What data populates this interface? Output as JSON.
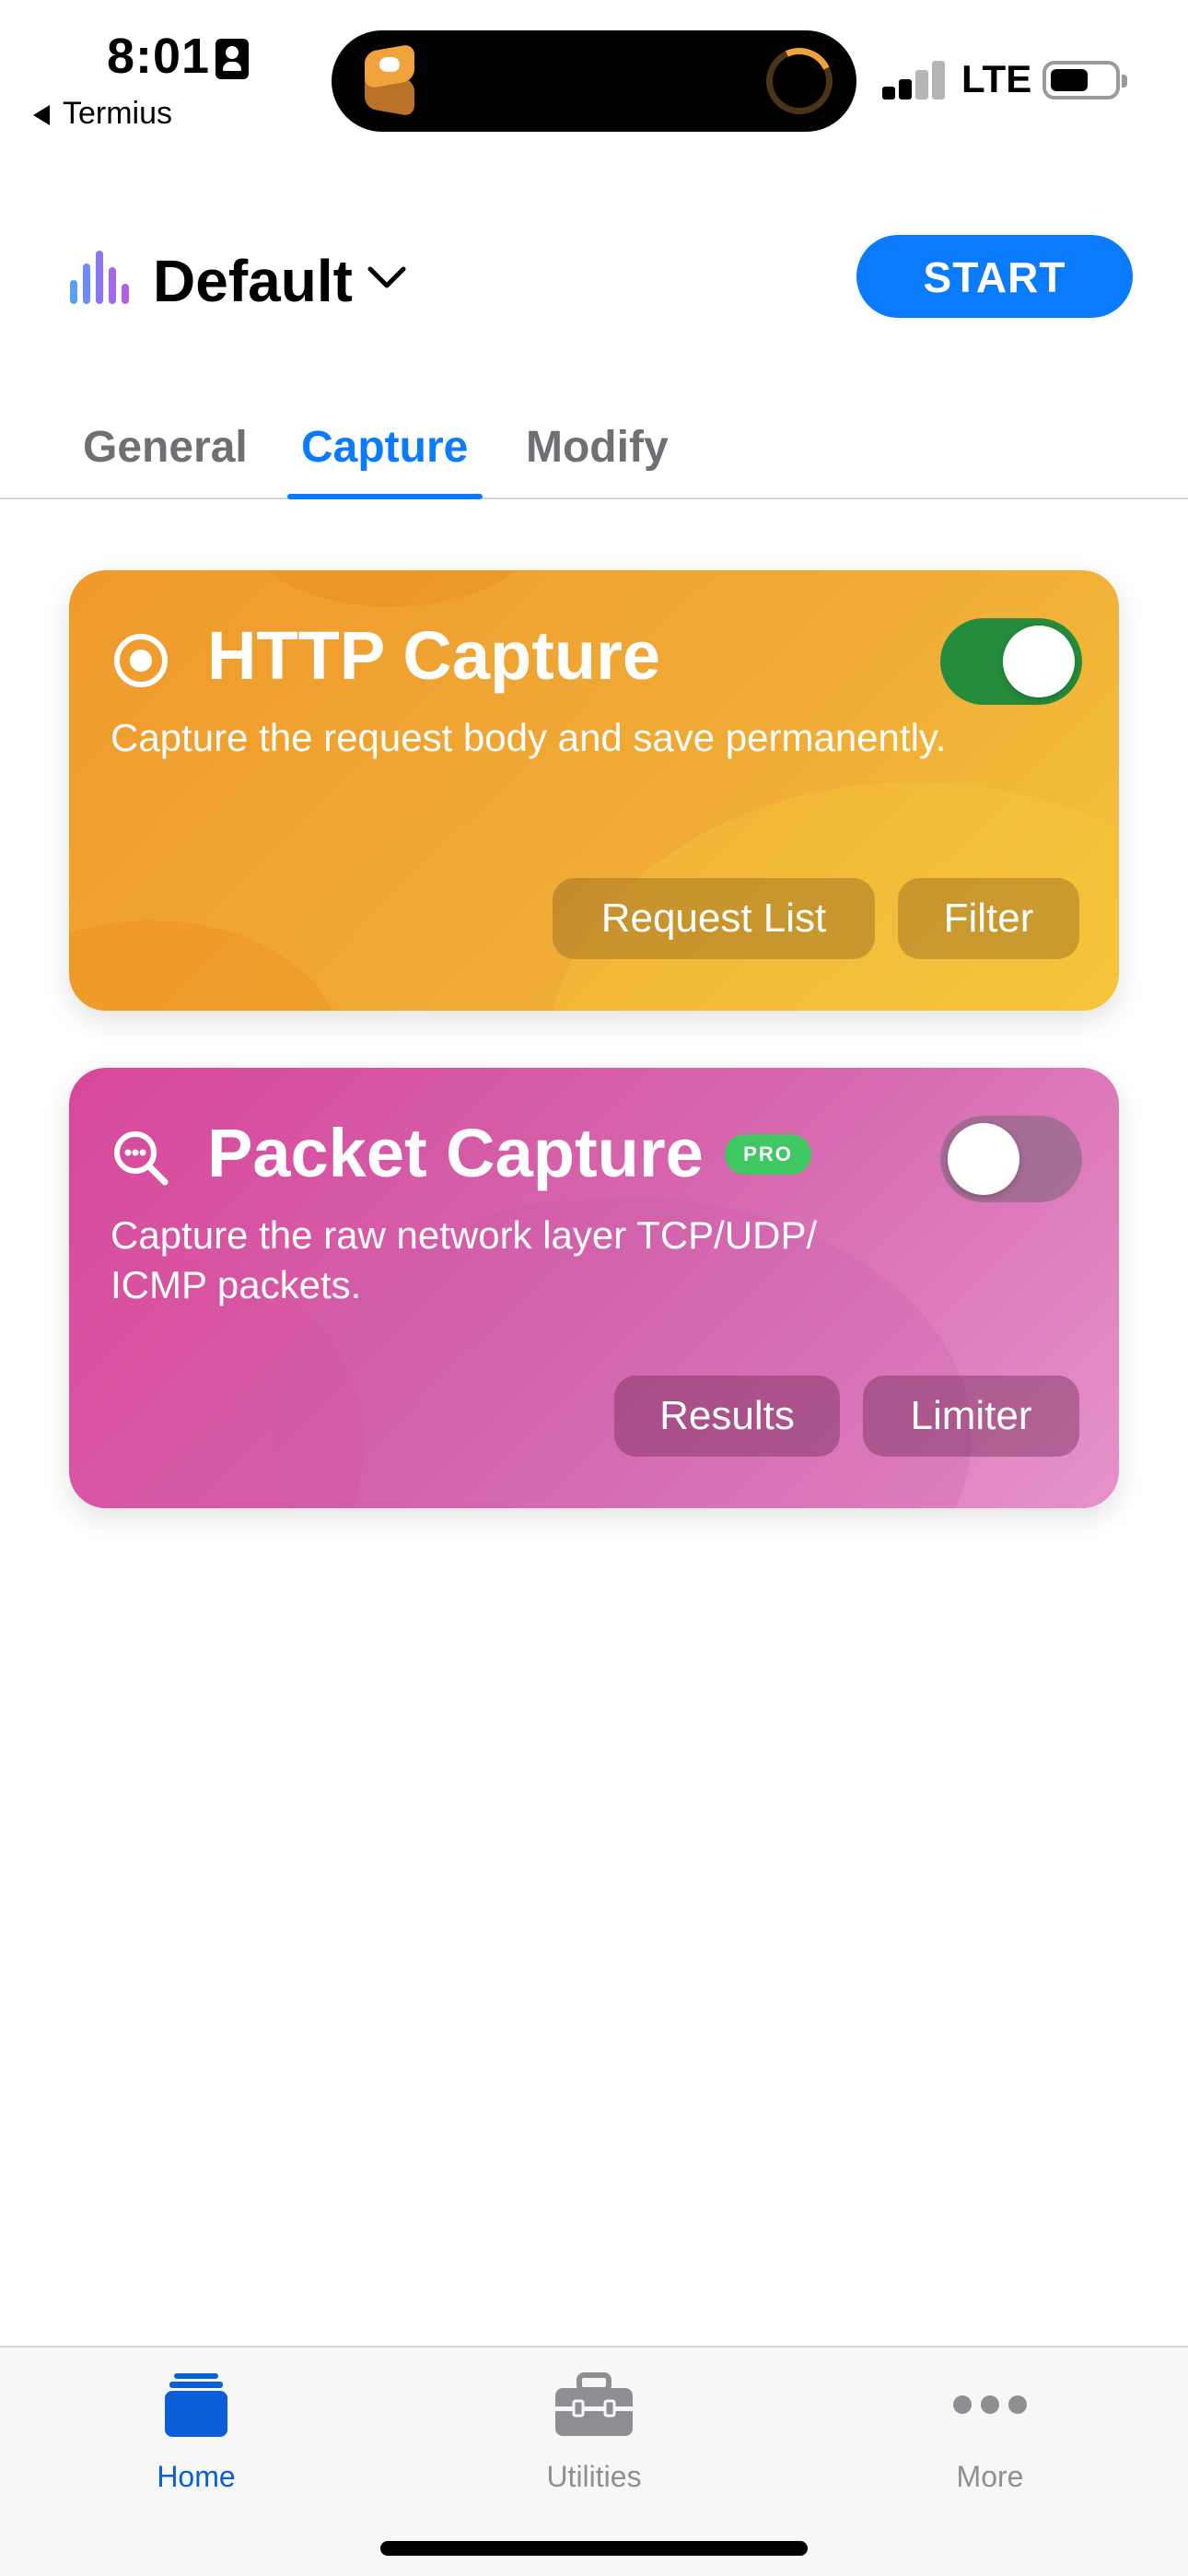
{
  "status_bar": {
    "time": "8:01",
    "back_app": "Termius",
    "network": "LTE",
    "signal_bars": 2,
    "signal_max": 4,
    "battery_level": 0.55
  },
  "header": {
    "profile_name": "Default",
    "start_label": "START"
  },
  "tabs": [
    {
      "label": "General",
      "active": false
    },
    {
      "label": "Capture",
      "active": true
    },
    {
      "label": "Modify",
      "active": false
    }
  ],
  "http_capture": {
    "title": "HTTP Capture",
    "description": "Capture the request body and save permanently.",
    "enabled": true,
    "buttons": [
      "Request List",
      "Filter"
    ],
    "icon": "record-icon"
  },
  "packet_capture": {
    "title": "Packet Capture",
    "badge": "PRO",
    "description": "Capture the raw network layer TCP/UDP/ ICMP packets.",
    "enabled": false,
    "buttons": [
      "Results",
      "Limiter"
    ],
    "icon": "magnifier-icon"
  },
  "tab_bar": {
    "items": [
      {
        "label": "Home",
        "icon": "home-stack-icon",
        "active": true
      },
      {
        "label": "Utilities",
        "icon": "toolbox-icon",
        "active": false
      },
      {
        "label": "More",
        "icon": "more-dots-icon",
        "active": false
      }
    ]
  },
  "colors": {
    "accent": "#0a7aff",
    "http_card": "#f0aa36",
    "packet_card": "#d666ae",
    "toggle_on": "#258c3b",
    "pro_badge": "#3fc861"
  }
}
